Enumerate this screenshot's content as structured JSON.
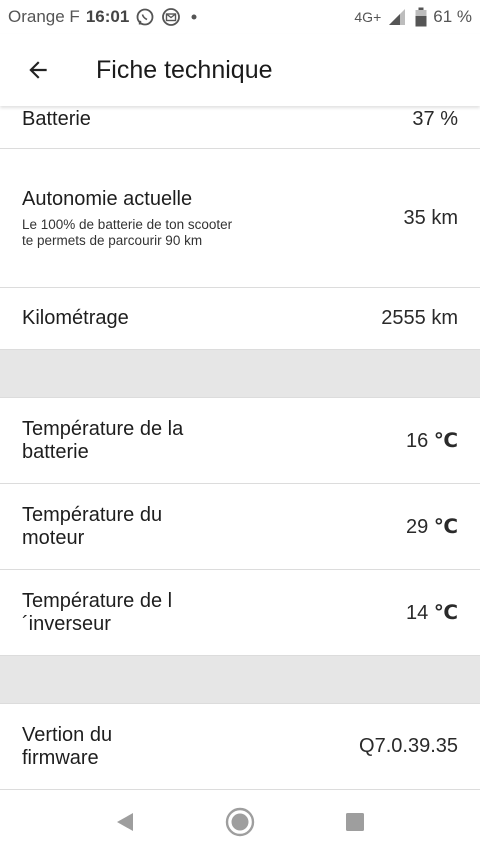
{
  "status_bar": {
    "carrier": "Orange F",
    "time": "16:01",
    "network": "4G+",
    "battery": "61 %"
  },
  "header": {
    "title": "Fiche technique"
  },
  "rows": {
    "battery": {
      "label": "Batterie",
      "value": "37 %"
    },
    "range": {
      "label": "Autonomie actuelle",
      "sub": "Le 100% de batterie de ton scooter te permets de parcourir 90 km",
      "value": "35 km"
    },
    "mileage": {
      "label": "Kilométrage",
      "value": "2555 km"
    },
    "battery_temp": {
      "label": "Température de la batterie",
      "value": "16",
      "unit": "℃"
    },
    "motor_temp": {
      "label": "Température du moteur",
      "value": "29",
      "unit": "℃"
    },
    "inverter_temp": {
      "label": "Température de l´inverseur",
      "value": "14",
      "unit": "℃"
    },
    "firmware": {
      "label": "Vertion du firmware",
      "value": "Q7.0.39.35"
    }
  },
  "icons": {
    "back": "arrow-left-icon",
    "whatsapp": "whatsapp-icon",
    "mail": "mail-icon",
    "signal": "signal-icon",
    "battery": "battery-icon",
    "nav_back": "triangle-back-icon",
    "nav_home": "circle-home-icon",
    "nav_recents": "square-recents-icon"
  },
  "colors": {
    "background": "#ffffff",
    "separator": "#e6e6e6",
    "divider": "#dcdcdc",
    "nav_icons": "#9e9e9e"
  }
}
